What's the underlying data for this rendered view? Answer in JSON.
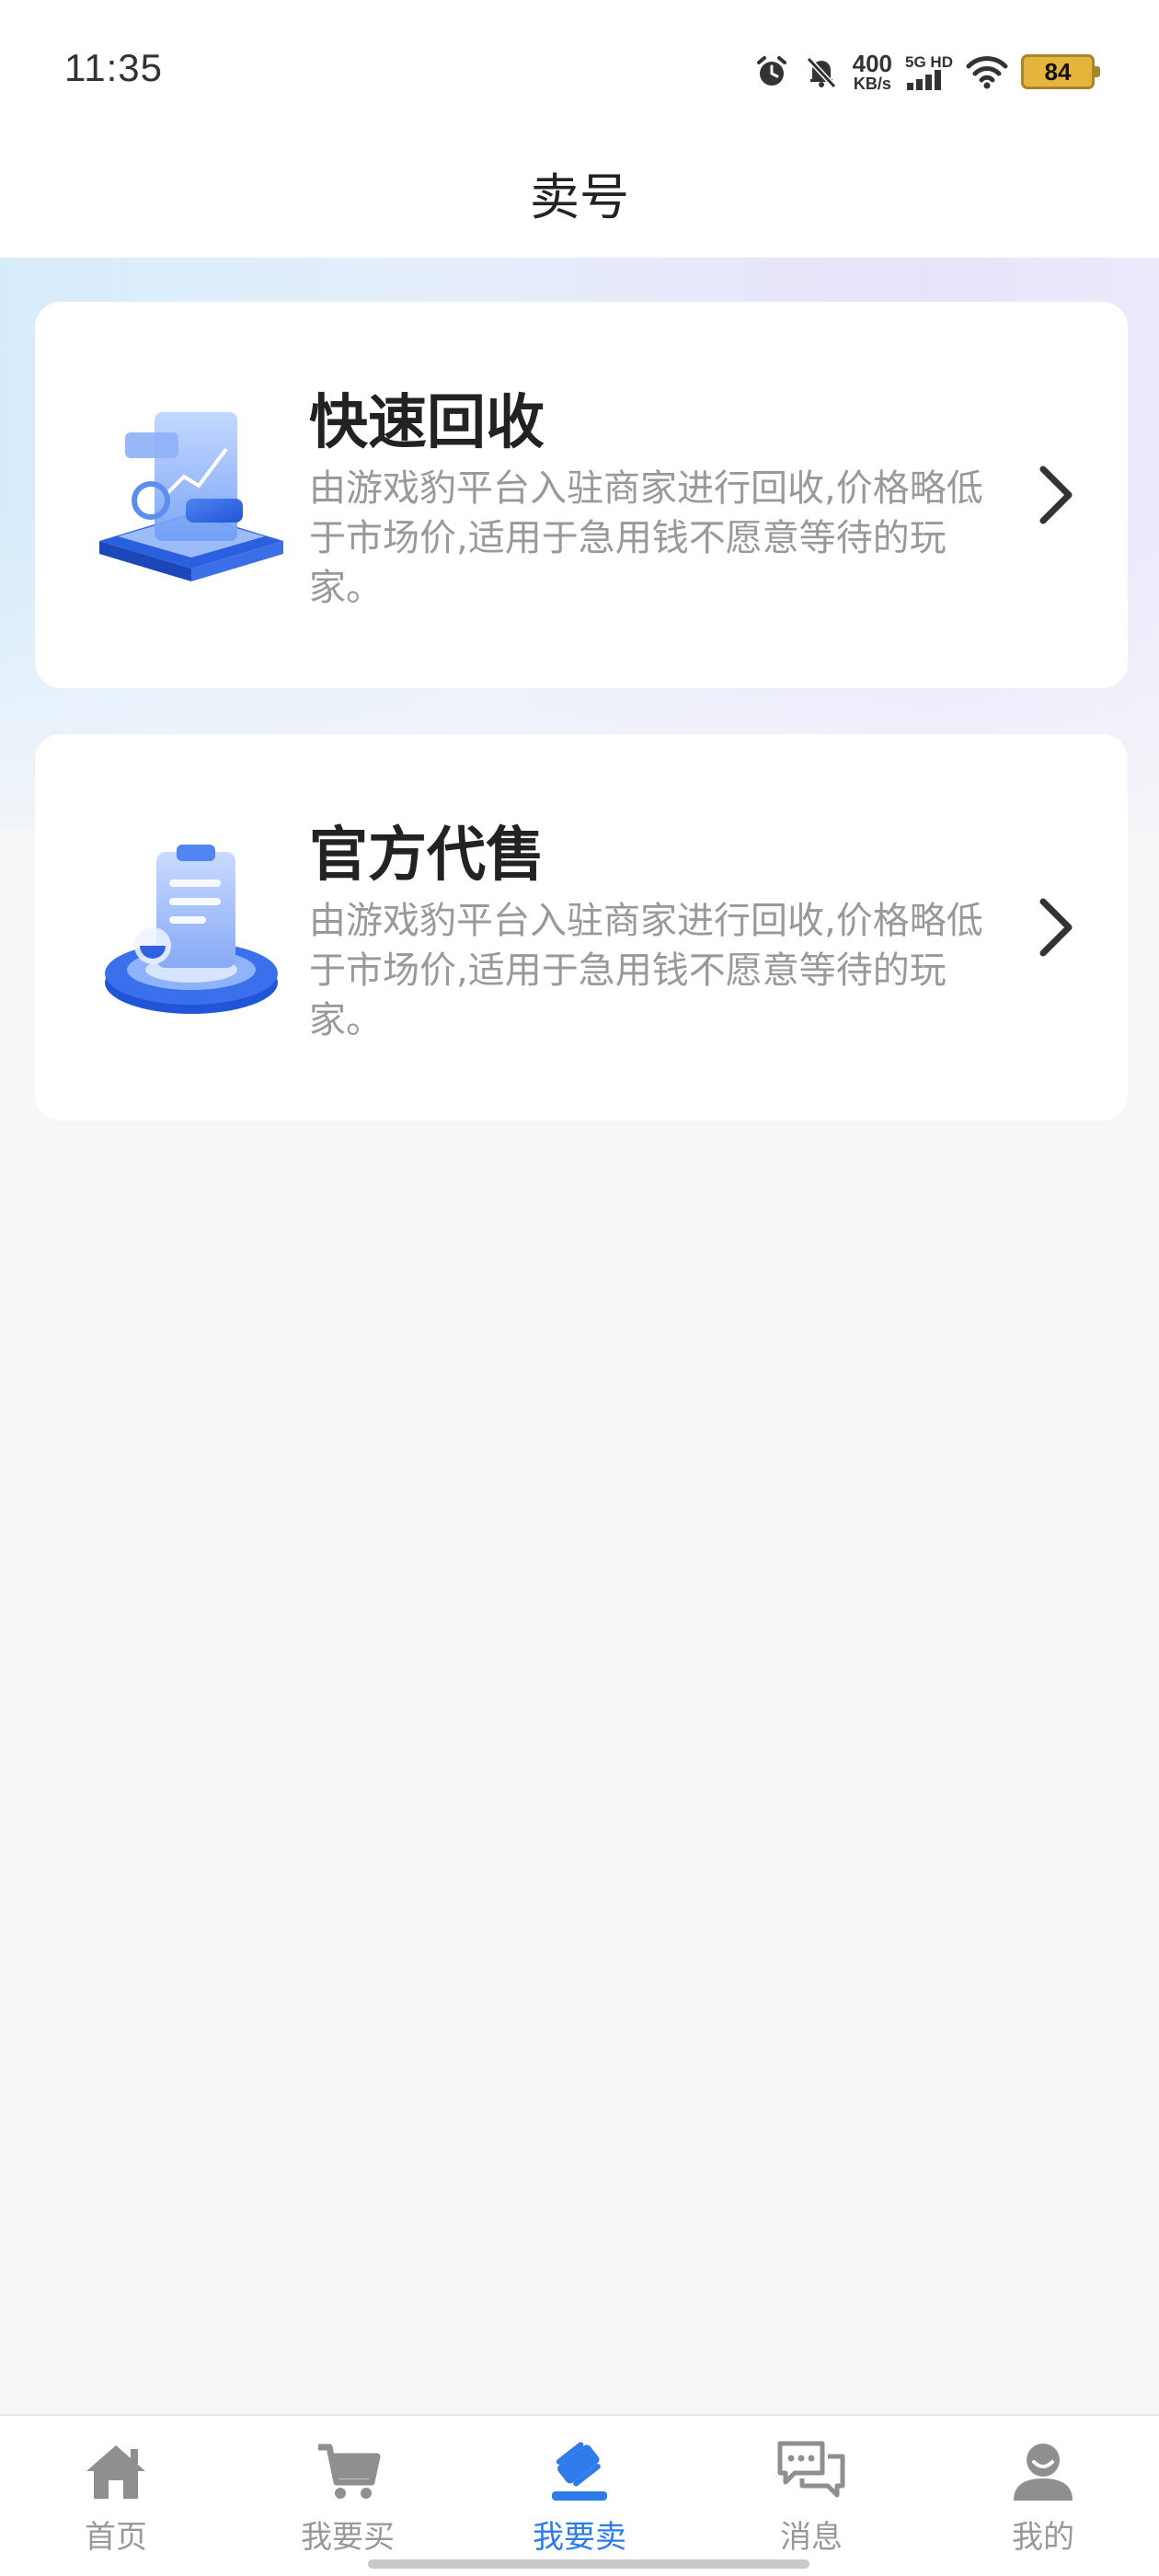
{
  "status_bar": {
    "time": "11:35",
    "speed_value": "400",
    "speed_unit": "KB/s",
    "network": "5G HD",
    "battery": "84"
  },
  "header": {
    "title": "卖号"
  },
  "cards": [
    {
      "title": "快速回收",
      "description": "由游戏豹平台入驻商家进行回收,价格略低于市场价,适用于急用钱不愿意等待的玩家。",
      "icon": "chart-document-illustration"
    },
    {
      "title": "官方代售",
      "description": "由游戏豹平台入驻商家进行回收,价格略低于市场价,适用于急用钱不愿意等待的玩家。",
      "icon": "clipboard-illustration"
    }
  ],
  "tab_bar": {
    "items": [
      {
        "label": "首页",
        "icon": "home-icon",
        "active": false
      },
      {
        "label": "我要买",
        "icon": "cart-icon",
        "active": false
      },
      {
        "label": "我要卖",
        "icon": "gavel-icon",
        "active": true
      },
      {
        "label": "消息",
        "icon": "chat-icon",
        "active": false
      },
      {
        "label": "我的",
        "icon": "user-icon",
        "active": false
      }
    ]
  },
  "colors": {
    "accent": "#2f7bea",
    "inactive": "#999999",
    "title": "#222222",
    "description": "#999999"
  }
}
